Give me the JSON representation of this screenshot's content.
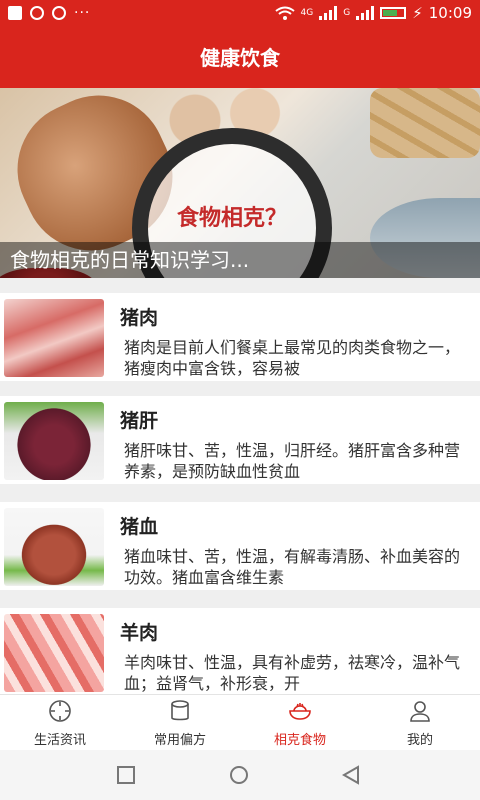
{
  "status_bar": {
    "network_label": "4G",
    "g_label": "G",
    "time": "10:09"
  },
  "header": {
    "title": "健康饮食"
  },
  "banner": {
    "overlay_text": "食物相克？",
    "caption": "食物相克的日常知识学习..."
  },
  "list": {
    "items": [
      {
        "title": "猪肉",
        "desc": "猪肉是目前人们餐桌上最常见的肉类食物之一，猪瘦肉中富含铁，容易被",
        "thumb_icon": "pork-thumbnail"
      },
      {
        "title": "猪肝",
        "desc": "猪肝味甘、苦，性温，归肝经。猪肝富含多种营养素，是预防缺血性贫血",
        "thumb_icon": "pig-liver-thumbnail"
      },
      {
        "title": "猪血",
        "desc": "猪血味甘、苦，性温，有解毒清肠、补血美容的功效。猪血富含维生素",
        "thumb_icon": "pig-blood-thumbnail"
      },
      {
        "title": "羊肉",
        "desc": "羊肉味甘、性温，具有补虚劳，祛寒冷，温补气血；益肾气，补形衰，开",
        "thumb_icon": "lamb-thumbnail"
      }
    ]
  },
  "bottom_nav": {
    "tabs": [
      {
        "label": "生活资讯",
        "icon": "compass-icon",
        "active": false
      },
      {
        "label": "常用偏方",
        "icon": "jar-icon",
        "active": false
      },
      {
        "label": "相克食物",
        "icon": "food-bowl-icon",
        "active": true
      },
      {
        "label": "我的",
        "icon": "user-icon",
        "active": false
      }
    ],
    "active_color": "#d9251d"
  },
  "colors": {
    "brand": "#d9251d"
  }
}
